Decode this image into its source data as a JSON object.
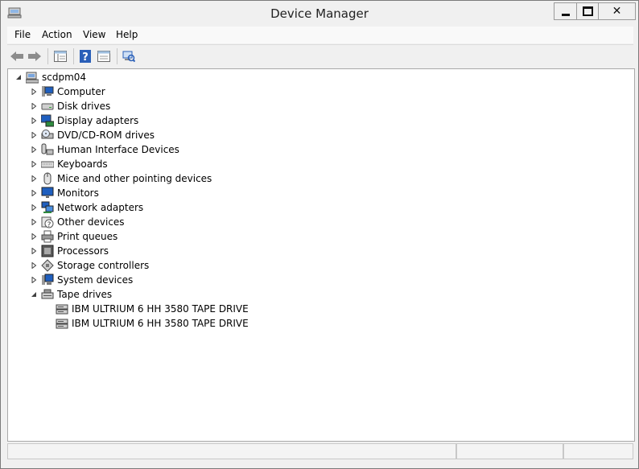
{
  "window": {
    "title": "Device Manager"
  },
  "menu": {
    "file": "File",
    "action": "Action",
    "view": "View",
    "help": "Help"
  },
  "toolbar": {
    "buttons": [
      "back-arrow-icon",
      "forward-arrow-icon",
      "properties-icon",
      "help-icon",
      "update-driver-icon",
      "scan-hardware-icon"
    ]
  },
  "tree": {
    "root": "scdpm04",
    "categories": [
      {
        "label": "Computer",
        "icon": "computer-icon"
      },
      {
        "label": "Disk drives",
        "icon": "disk-drive-icon"
      },
      {
        "label": "Display adapters",
        "icon": "display-adapter-icon"
      },
      {
        "label": "DVD/CD-ROM drives",
        "icon": "dvd-drive-icon"
      },
      {
        "label": "Human Interface Devices",
        "icon": "hid-icon"
      },
      {
        "label": "Keyboards",
        "icon": "keyboard-icon"
      },
      {
        "label": "Mice and other pointing devices",
        "icon": "mouse-icon"
      },
      {
        "label": "Monitors",
        "icon": "monitor-icon"
      },
      {
        "label": "Network adapters",
        "icon": "network-adapter-icon"
      },
      {
        "label": "Other devices",
        "icon": "unknown-device-icon"
      },
      {
        "label": "Print queues",
        "icon": "printer-icon"
      },
      {
        "label": "Processors",
        "icon": "processor-icon"
      },
      {
        "label": "Storage controllers",
        "icon": "storage-controller-icon"
      },
      {
        "label": "System devices",
        "icon": "system-device-icon"
      },
      {
        "label": "Tape drives",
        "icon": "tape-drive-icon",
        "expanded": true
      }
    ],
    "tape_drives": [
      "IBM ULTRIUM 6 HH 3580 TAPE DRIVE",
      "IBM ULTRIUM 6 HH 3580 TAPE DRIVE"
    ]
  },
  "colors": {
    "window_bg": "#f0f0f0",
    "tree_bg": "#ffffff",
    "icon_blue": "#1f5fbf"
  }
}
